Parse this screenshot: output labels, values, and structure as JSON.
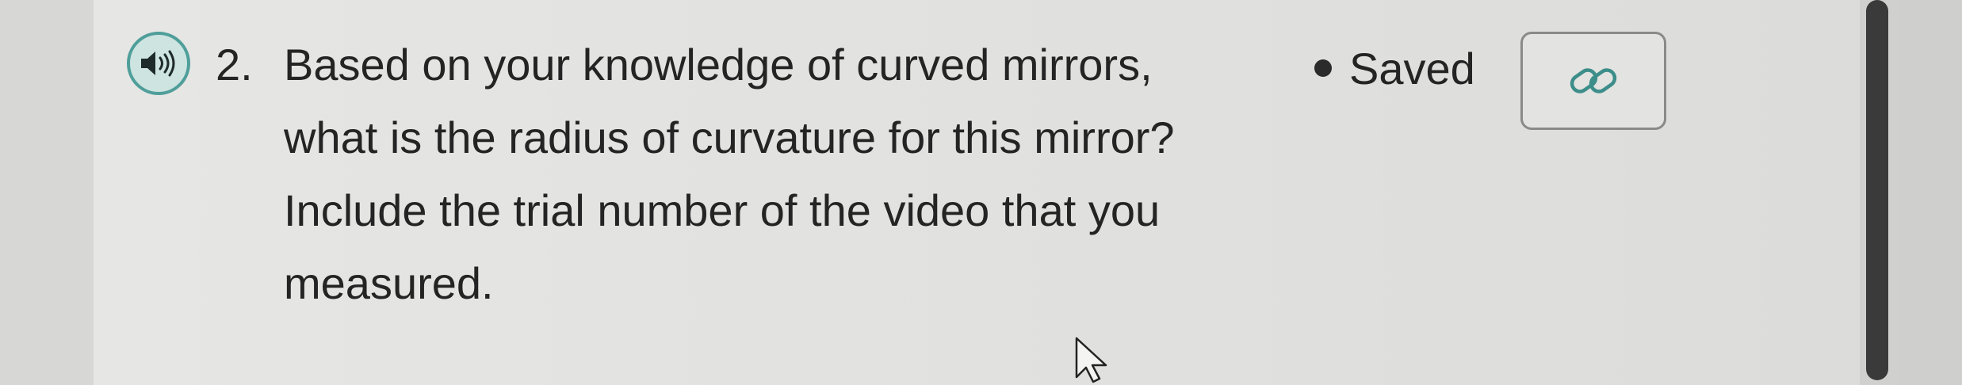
{
  "question": {
    "number": "2.",
    "lines": [
      "Based on your knowledge of curved mirrors,",
      "what is the radius of curvature for this mirror?",
      "Include the trial number of the video that you",
      "measured."
    ]
  },
  "status": {
    "label": "Saved"
  },
  "icons": {
    "audio": "speaker-icon",
    "link": "link-icon",
    "cursor": "mouse-pointer-icon"
  },
  "colors": {
    "accent": "#4f9e9a",
    "text": "#242424",
    "scrollbar": "#3a3a3a"
  }
}
